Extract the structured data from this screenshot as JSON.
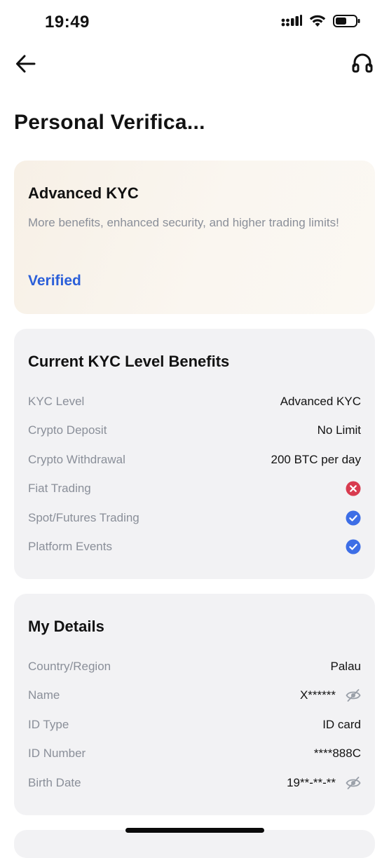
{
  "status_bar": {
    "time": "19:49"
  },
  "nav": {
    "back_icon": "back-arrow-icon",
    "support_icon": "headset-icon"
  },
  "page": {
    "title": "Personal Verifica..."
  },
  "kyc_card": {
    "title": "Advanced KYC",
    "description": "More benefits, enhanced security, and higher trading limits!",
    "status": "Verified",
    "status_color": "#2b5fd9"
  },
  "benefits": {
    "title": "Current KYC Level Benefits",
    "rows": [
      {
        "label": "KYC Level",
        "value": "Advanced KYC"
      },
      {
        "label": "Crypto Deposit",
        "value": "No Limit"
      },
      {
        "label": "Crypto Withdrawal",
        "value": "200 BTC per day"
      },
      {
        "label": "Fiat Trading",
        "icon": "red-x-icon"
      },
      {
        "label": "Spot/Futures Trading",
        "icon": "blue-check-icon"
      },
      {
        "label": "Platform Events",
        "icon": "blue-check-icon"
      }
    ]
  },
  "details": {
    "title": "My Details",
    "rows": [
      {
        "label": "Country/Region",
        "value": "Palau"
      },
      {
        "label": "Name",
        "value": "X******",
        "icon": "eye-slash-icon"
      },
      {
        "label": "ID Type",
        "value": "ID card"
      },
      {
        "label": "ID Number",
        "value": "****888C"
      },
      {
        "label": "Birth Date",
        "value": "19**-**-**",
        "icon": "eye-slash-icon"
      }
    ]
  },
  "colors": {
    "accent_blue": "#2b5fd9",
    "check_blue": "#3d6ee6",
    "error_red": "#d83b4f",
    "card_gray": "#f2f2f4"
  }
}
